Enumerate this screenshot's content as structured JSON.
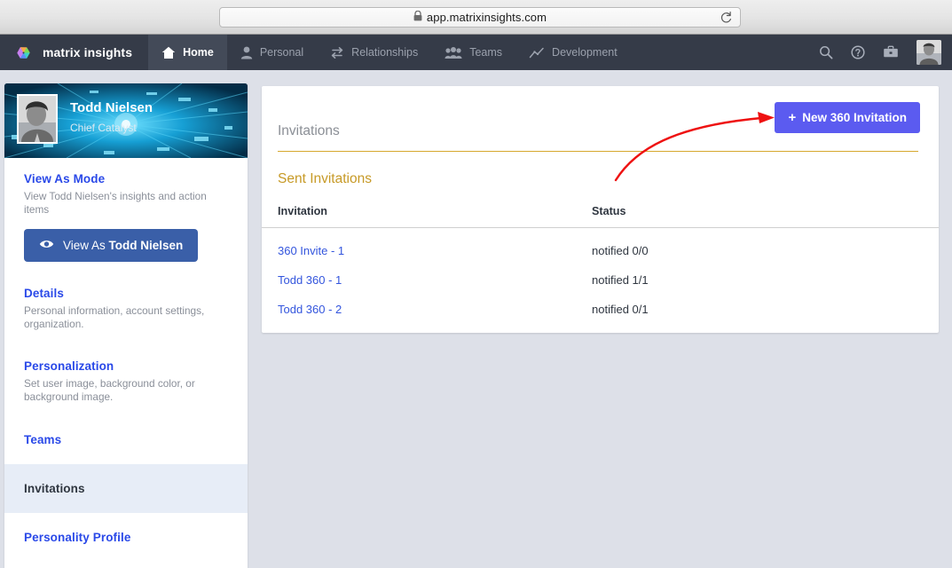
{
  "browser": {
    "url": "app.matrixinsights.com",
    "lock_icon": "lock-icon",
    "reload_icon": "reload-icon"
  },
  "navbar": {
    "brand": "matrix insights",
    "brand_logo_icon": "matrix-hexagon-logo-icon",
    "items": [
      {
        "label": "Home",
        "icon": "home-icon",
        "active": true
      },
      {
        "label": "Personal",
        "icon": "person-icon",
        "active": false
      },
      {
        "label": "Relationships",
        "icon": "exchange-arrows-icon",
        "active": false
      },
      {
        "label": "Teams",
        "icon": "group-people-icon",
        "active": false
      },
      {
        "label": "Development",
        "icon": "trend-line-chart-icon",
        "active": false
      }
    ],
    "right_icons": [
      {
        "name": "search-icon"
      },
      {
        "name": "help-circle-icon"
      },
      {
        "name": "briefcase-icon"
      }
    ],
    "avatar_alt": "user-avatar"
  },
  "sidebar": {
    "profile": {
      "name": "Todd Nielsen",
      "title": "Chief Catalyst",
      "photo_alt": "profile-photo"
    },
    "view_as": {
      "heading": "View As Mode",
      "description": "View Todd Nielsen's insights and action items",
      "button_prefix": "View As ",
      "button_name": "Todd Nielsen",
      "button_icon": "eye-icon"
    },
    "sections": [
      {
        "heading": "Details",
        "description": "Personal information, account settings, organization."
      },
      {
        "heading": "Personalization",
        "description": "Set user image, background color, or background image."
      }
    ],
    "items": [
      {
        "label": "Teams",
        "active": false
      },
      {
        "label": "Invitations",
        "active": true
      },
      {
        "label": "Personality Profile",
        "active": false
      }
    ]
  },
  "main": {
    "title": "Invitations",
    "new_button": {
      "label": "New 360 Invitation",
      "plus": "+",
      "color": "#5b5bf0"
    },
    "subsection": "Sent Invitations",
    "table": {
      "columns": [
        "Invitation",
        "Status"
      ],
      "rows": [
        {
          "invitation": "360 Invite - 1",
          "status": "notified 0/0"
        },
        {
          "invitation": "Todd 360 - 1",
          "status": "notified 1/1"
        },
        {
          "invitation": "Todd 360 - 2",
          "status": "notified 0/1"
        }
      ]
    }
  },
  "annotation": {
    "arrow_color": "#ee1111",
    "name": "red-curved-arrow-to-new-invitation-button"
  },
  "colors": {
    "nav_bg": "#353b48",
    "page_bg": "#dde0e8",
    "accent_gold": "#c79a27",
    "link_blue": "#2a49e8",
    "button_indigo": "#5b5bf0",
    "viewas_blue": "#3a5fa8"
  }
}
